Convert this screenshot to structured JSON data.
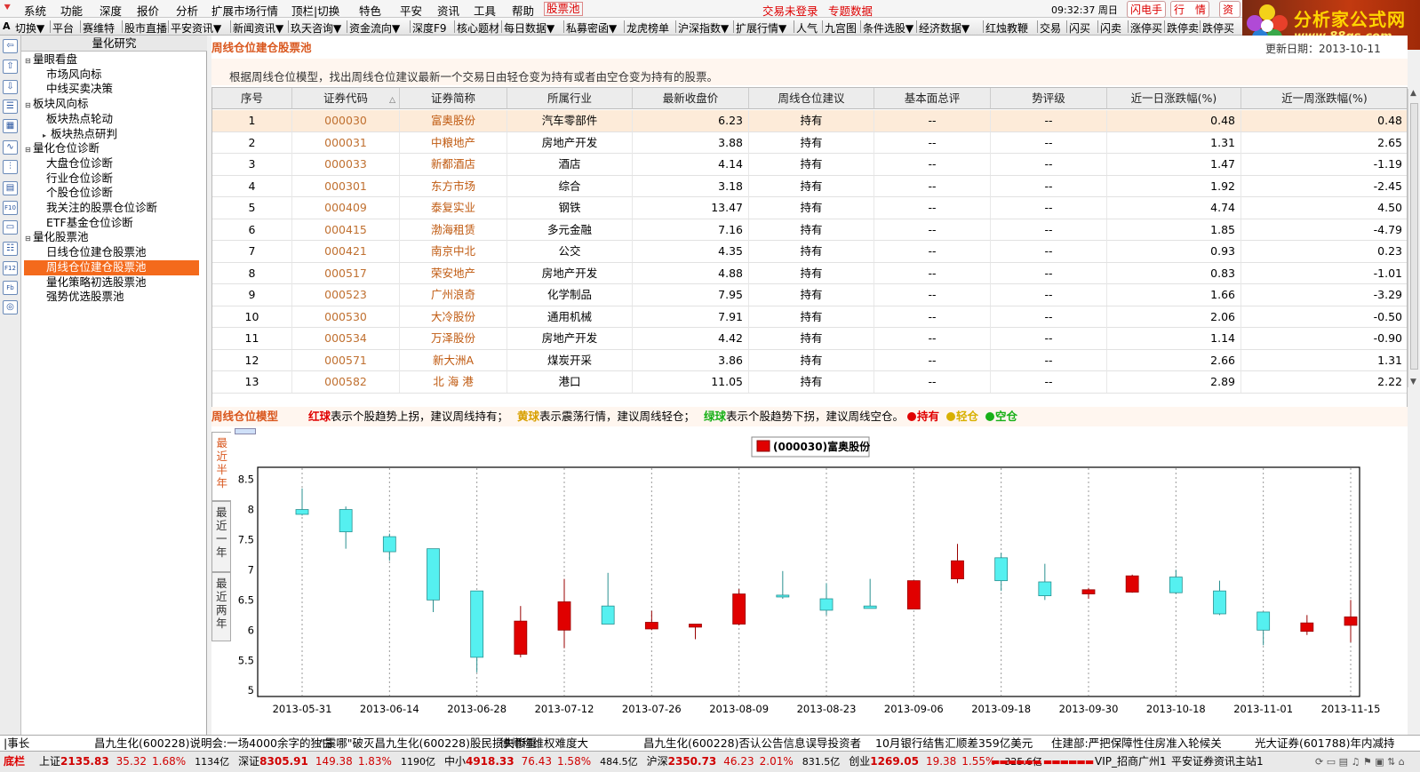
{
  "menubar": {
    "items": [
      "系统",
      "功能",
      "深度",
      "报价",
      "分析",
      "扩展市场行情",
      "顶栏|切换",
      "特色",
      "平安",
      "资讯",
      "工具",
      "帮助"
    ],
    "pool_tab": "股票池",
    "login_status": "交易未登录",
    "topic_data": "专题数据",
    "clock": "09:32:37 周日",
    "buttons": [
      "闪电手",
      "行　情",
      "资"
    ]
  },
  "logo": {
    "title": "分析家公式网",
    "url": "www.88gs.com"
  },
  "toolbar": {
    "items": [
      "切换▼",
      "平台",
      "赛维特",
      "股市直播",
      "平安资讯▼",
      "新闻资讯▼",
      "玖天咨询▼",
      "资金流向▼",
      "深度F9",
      "核心题材",
      "每日数据▼",
      "私募密函▼",
      "龙虎榜单",
      "沪深指数▼",
      "扩展行情▼",
      "人气",
      "九宫图",
      "条件选股▼",
      "经济数据▼",
      "红烛教鞭",
      "交易",
      "闪买",
      "闪卖",
      "涨停买",
      "跌停卖",
      "跌停买"
    ]
  },
  "sidebar_icons": [
    "arrow-left-icon",
    "arrow-up-icon",
    "arrow-down-icon",
    "list-icon",
    "grid-icon",
    "line-chart-icon",
    "candle-icon",
    "report-icon",
    "f10-icon",
    "news-icon",
    "notes-icon",
    "f12-icon",
    "f10-alt-icon",
    "circle-icon"
  ],
  "tree": {
    "title": "量化研究",
    "nodes": [
      {
        "label": "量眼看盘",
        "level": 0,
        "toggle": "▬"
      },
      {
        "label": "市场风向标",
        "level": 1
      },
      {
        "label": "中线买卖决策",
        "level": 1
      },
      {
        "label": "板块风向标",
        "level": 0,
        "toggle": "▬"
      },
      {
        "label": "板块热点轮动",
        "level": 1
      },
      {
        "label": "板块热点研判",
        "level": 1,
        "toggle": "▸"
      },
      {
        "label": "量化仓位诊断",
        "level": 0,
        "toggle": "▬"
      },
      {
        "label": "大盘仓位诊断",
        "level": 1
      },
      {
        "label": "行业仓位诊断",
        "level": 1
      },
      {
        "label": "个股仓位诊断",
        "level": 1
      },
      {
        "label": "我关注的股票仓位诊断",
        "level": 1
      },
      {
        "label": "ETF基金仓位诊断",
        "level": 1
      },
      {
        "label": "量化股票池",
        "level": 0,
        "toggle": "▬"
      },
      {
        "label": "日线仓位建仓股票池",
        "level": 1
      },
      {
        "label": "周线仓位建仓股票池",
        "level": 1,
        "selected": true
      },
      {
        "label": "量化策略初选股票池",
        "level": 1
      },
      {
        "label": "强势优选股票池",
        "level": 1
      }
    ]
  },
  "pool": {
    "title": "周线仓位建仓股票池",
    "description": "根据周线仓位模型，找出周线仓位建议最新一个交易日由轻仓变为持有或者由空仓变为持有的股票。",
    "update_date": "更新日期：2013-10-11"
  },
  "table": {
    "columns": [
      "序号",
      "证券代码",
      "证券简称",
      "所属行业",
      "最新收盘价",
      "周线仓位建议",
      "基本面总评",
      "势评级",
      "近一日涨跌幅(%)",
      "近一周涨跌幅(%)"
    ],
    "sort_indicator": "△",
    "rows": [
      [
        "1",
        "000030",
        "富奥股份",
        "汽车零部件",
        "6.23",
        "持有",
        "--",
        "--",
        "0.48",
        "0.48"
      ],
      [
        "2",
        "000031",
        "中粮地产",
        "房地产开发",
        "3.88",
        "持有",
        "--",
        "--",
        "1.31",
        "2.65"
      ],
      [
        "3",
        "000033",
        "新都酒店",
        "酒店",
        "4.14",
        "持有",
        "--",
        "--",
        "1.47",
        "-1.19"
      ],
      [
        "4",
        "000301",
        "东方市场",
        "综合",
        "3.18",
        "持有",
        "--",
        "--",
        "1.92",
        "-2.45"
      ],
      [
        "5",
        "000409",
        "泰复实业",
        "钢铁",
        "13.47",
        "持有",
        "--",
        "--",
        "4.74",
        "4.50"
      ],
      [
        "6",
        "000415",
        "渤海租赁",
        "多元金融",
        "7.16",
        "持有",
        "--",
        "--",
        "1.85",
        "-4.79"
      ],
      [
        "7",
        "000421",
        "南京中北",
        "公交",
        "4.35",
        "持有",
        "--",
        "--",
        "0.93",
        "0.23"
      ],
      [
        "8",
        "000517",
        "荣安地产",
        "房地产开发",
        "4.88",
        "持有",
        "--",
        "--",
        "0.83",
        "-1.01"
      ],
      [
        "9",
        "000523",
        "广州浪奇",
        "化学制品",
        "7.95",
        "持有",
        "--",
        "--",
        "1.66",
        "-3.29"
      ],
      [
        "10",
        "000530",
        "大冷股份",
        "通用机械",
        "7.91",
        "持有",
        "--",
        "--",
        "2.06",
        "-0.50"
      ],
      [
        "11",
        "000534",
        "万泽股份",
        "房地产开发",
        "4.42",
        "持有",
        "--",
        "--",
        "1.14",
        "-0.90"
      ],
      [
        "12",
        "000571",
        "新大洲A",
        "煤炭开采",
        "3.86",
        "持有",
        "--",
        "--",
        "2.66",
        "1.31"
      ],
      [
        "13",
        "000582",
        "北 海 港",
        "港口",
        "11.05",
        "持有",
        "--",
        "--",
        "2.89",
        "2.22"
      ]
    ]
  },
  "model": {
    "title": "周线仓位模型",
    "red_term": "红球",
    "red_text": "表示个股趋势上拐，建议周线持有；",
    "yellow_term": "黄球",
    "yellow_text": "表示震荡行情，建议周线轻仓；",
    "green_term": "绿球",
    "green_text": "表示个股趋势下拐，建议周线空仓。",
    "legend_hold": "持有",
    "legend_light": "轻仓",
    "legend_empty": "空仓",
    "colors": {
      "red": "#e00000",
      "yellow": "#d8b000",
      "green": "#18b018"
    }
  },
  "chart_tabs": [
    "最近半年",
    "最近一年",
    "最近两年"
  ],
  "chart_data": {
    "type": "candlestick",
    "title": "(000030)富奥股份",
    "ylim": [
      4.9,
      8.7
    ],
    "yticks": [
      5.0,
      5.5,
      6.0,
      6.5,
      7.0,
      7.5,
      8.0,
      8.5
    ],
    "xticks": [
      "2013-05-31",
      "2013-06-14",
      "2013-06-28",
      "2013-07-12",
      "2013-07-26",
      "2013-08-09",
      "2013-08-23",
      "2013-09-06",
      "2013-09-18",
      "2013-09-30",
      "2013-10-18",
      "2013-11-01",
      "2013-11-15"
    ],
    "colors": {
      "up": "#e00000",
      "down": "#55f0f0"
    },
    "candles": [
      {
        "o": 8.0,
        "h": 8.35,
        "l": 7.9,
        "c": 7.92,
        "d": "down"
      },
      {
        "o": 8.0,
        "h": 8.05,
        "l": 7.35,
        "c": 7.63,
        "d": "down"
      },
      {
        "o": 7.55,
        "h": 7.6,
        "l": 7.15,
        "c": 7.3,
        "d": "down"
      },
      {
        "o": 7.35,
        "h": 7.35,
        "l": 6.3,
        "c": 6.5,
        "d": "down"
      },
      {
        "o": 6.65,
        "h": 6.65,
        "l": 5.3,
        "c": 5.55,
        "d": "down"
      },
      {
        "o": 5.6,
        "h": 6.4,
        "l": 5.55,
        "c": 6.15,
        "d": "up"
      },
      {
        "o": 6.0,
        "h": 6.85,
        "l": 5.7,
        "c": 6.47,
        "d": "up"
      },
      {
        "o": 6.4,
        "h": 6.95,
        "l": 6.1,
        "c": 6.1,
        "d": "down"
      },
      {
        "o": 6.02,
        "h": 6.32,
        "l": 6.0,
        "c": 6.13,
        "d": "up"
      },
      {
        "o": 6.05,
        "h": 6.1,
        "l": 5.85,
        "c": 6.1,
        "d": "up"
      },
      {
        "o": 6.1,
        "h": 6.68,
        "l": 6.08,
        "c": 6.6,
        "d": "up"
      },
      {
        "o": 6.58,
        "h": 6.98,
        "l": 6.52,
        "c": 6.55,
        "d": "down"
      },
      {
        "o": 6.52,
        "h": 6.78,
        "l": 6.25,
        "c": 6.33,
        "d": "down"
      },
      {
        "o": 6.4,
        "h": 6.85,
        "l": 6.36,
        "c": 6.36,
        "d": "down"
      },
      {
        "o": 6.35,
        "h": 6.82,
        "l": 6.35,
        "c": 6.82,
        "d": "up"
      },
      {
        "o": 6.85,
        "h": 7.43,
        "l": 6.78,
        "c": 7.15,
        "d": "up"
      },
      {
        "o": 7.2,
        "h": 7.28,
        "l": 6.65,
        "c": 6.82,
        "d": "down"
      },
      {
        "o": 6.8,
        "h": 7.1,
        "l": 6.5,
        "c": 6.57,
        "d": "down"
      },
      {
        "o": 6.6,
        "h": 6.7,
        "l": 6.52,
        "c": 6.67,
        "d": "up"
      },
      {
        "o": 6.63,
        "h": 6.92,
        "l": 6.62,
        "c": 6.9,
        "d": "up"
      },
      {
        "o": 6.88,
        "h": 7.0,
        "l": 6.6,
        "c": 6.62,
        "d": "down"
      },
      {
        "o": 6.65,
        "h": 6.82,
        "l": 6.25,
        "c": 6.27,
        "d": "down"
      },
      {
        "o": 6.3,
        "h": 6.3,
        "l": 5.75,
        "c": 6.0,
        "d": "down"
      },
      {
        "o": 5.98,
        "h": 6.25,
        "l": 5.92,
        "c": 6.12,
        "d": "up"
      },
      {
        "o": 6.08,
        "h": 6.5,
        "l": 5.8,
        "c": 6.22,
        "d": "up"
      }
    ]
  },
  "ticker": {
    "items": [
      "|事长",
      "昌九生化(600228)说明会:一场4000余字的独白",
      "\"震哪\"破灭昌九生化(600228)股民损失惨重",
      "律师称维权难度大",
      "昌九生化(600228)否认公告信息误导投资者",
      "10月银行结售汇顺差359亿美元",
      "住建部:严把保障性住房准入轮候关",
      "光大证券(601788)年内减持"
    ]
  },
  "status": {
    "label": "底栏",
    "indices": [
      {
        "name": "上证",
        "value": "2135.83",
        "chg": "35.32",
        "pct": "1.68%",
        "vol": "1134亿"
      },
      {
        "name": "深证",
        "value": "8305.91",
        "chg": "149.38",
        "pct": "1.83%",
        "vol": "1190亿"
      },
      {
        "name": "中小",
        "value": "4918.33",
        "chg": "76.43",
        "pct": "1.58%",
        "vol": "484.5亿"
      },
      {
        "name": "沪深",
        "value": "2350.73",
        "chg": "46.23",
        "pct": "2.01%",
        "vol": "831.5亿"
      },
      {
        "name": "创业",
        "value": "1269.05",
        "chg": "19.38",
        "pct": "1.55%",
        "vol": "325.6亿"
      }
    ],
    "server": "VIP_招商广州1",
    "site": "平安证券资讯主站1"
  }
}
